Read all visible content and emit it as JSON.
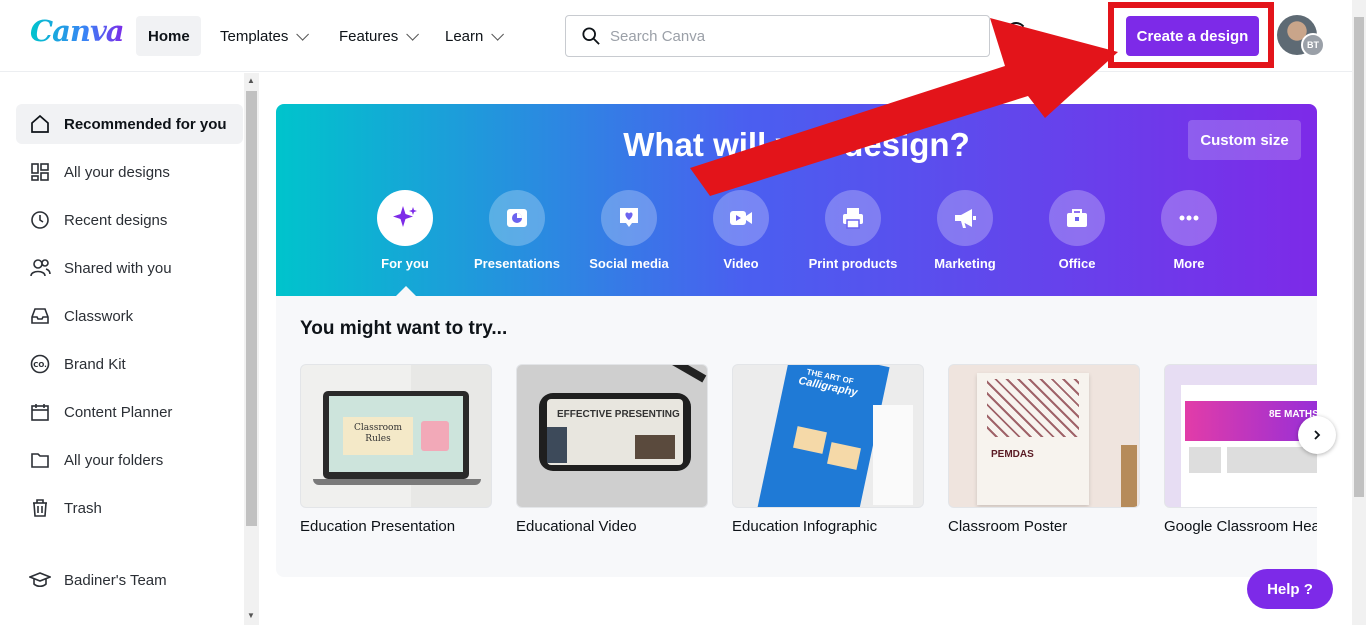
{
  "header": {
    "logo": "Canva",
    "nav": [
      {
        "label": "Home"
      },
      {
        "label": "Templates"
      },
      {
        "label": "Features"
      },
      {
        "label": "Learn"
      }
    ],
    "search_placeholder": "Search Canva",
    "create_label": "Create a design",
    "avatar_initials": "BT"
  },
  "sidebar": {
    "items": [
      {
        "label": "Recommended for you",
        "icon": "home-icon"
      },
      {
        "label": "All your designs",
        "icon": "grid-icon"
      },
      {
        "label": "Recent designs",
        "icon": "clock-icon"
      },
      {
        "label": "Shared with you",
        "icon": "people-icon"
      },
      {
        "label": "Classwork",
        "icon": "inbox-icon"
      },
      {
        "label": "Brand Kit",
        "icon": "brand-icon"
      },
      {
        "label": "Content Planner",
        "icon": "calendar-icon"
      },
      {
        "label": "All your folders",
        "icon": "folder-icon"
      },
      {
        "label": "Trash",
        "icon": "trash-icon"
      }
    ],
    "team": {
      "label": "Badiner's Team",
      "icon": "graduation-cap-icon"
    }
  },
  "hero": {
    "title": "What will you design?",
    "custom_size": "Custom size",
    "categories": [
      {
        "label": "For you"
      },
      {
        "label": "Presentations"
      },
      {
        "label": "Social media"
      },
      {
        "label": "Video"
      },
      {
        "label": "Print products"
      },
      {
        "label": "Marketing"
      },
      {
        "label": "Office"
      },
      {
        "label": "More"
      }
    ]
  },
  "suggestions": {
    "title": "You might want to try...",
    "cards": [
      {
        "title": "Education Presentation",
        "thumb_text": [
          "Classroom",
          "Rules"
        ]
      },
      {
        "title": "Educational Video",
        "thumb_text": [
          "EFFECTIVE PRESENTING"
        ]
      },
      {
        "title": "Education Infographic",
        "thumb_text": [
          "THE ART OF",
          "Calligraphy"
        ]
      },
      {
        "title": "Classroom Poster",
        "thumb_text": [
          "PEMDAS"
        ]
      },
      {
        "title": "Google Classroom Hea",
        "thumb_text": [
          "8E MATHS"
        ]
      }
    ]
  },
  "help_label": "Help ?",
  "colors": {
    "brand": "#7d2ae8",
    "highlight": "#e3141a"
  }
}
